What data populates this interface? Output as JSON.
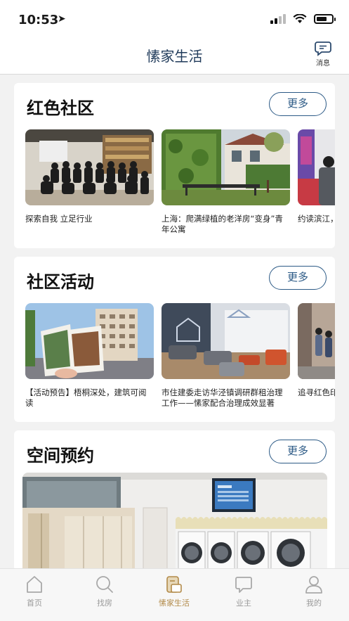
{
  "status": {
    "time": "10:53"
  },
  "nav": {
    "title": "愫家生活",
    "message_label": "消息"
  },
  "sections": [
    {
      "title": "红色社区",
      "more": "更多",
      "items": [
        {
          "caption": "探索自我 立足行业"
        },
        {
          "caption": "上海：爬满绿植的老洋房“变身”青年公寓"
        },
        {
          "caption": "约读滨江，"
        }
      ]
    },
    {
      "title": "社区活动",
      "more": "更多",
      "items": [
        {
          "caption": "【活动预告】梧桐深处，建筑可阅读"
        },
        {
          "caption": "市住建委走访华泾镇调研群租治理工作——愫家配合治理成效显著"
        },
        {
          "caption": "追寻红色印"
        }
      ]
    },
    {
      "title": "空间预约",
      "more": "更多"
    }
  ],
  "tabs": [
    {
      "label": "首页"
    },
    {
      "label": "找房"
    },
    {
      "label": "愫家生活"
    },
    {
      "label": "业主"
    },
    {
      "label": "我的"
    }
  ],
  "accent_color": "#b28a49",
  "nav_title_color": "#1f3a5a",
  "button_color": "#2c5a86"
}
